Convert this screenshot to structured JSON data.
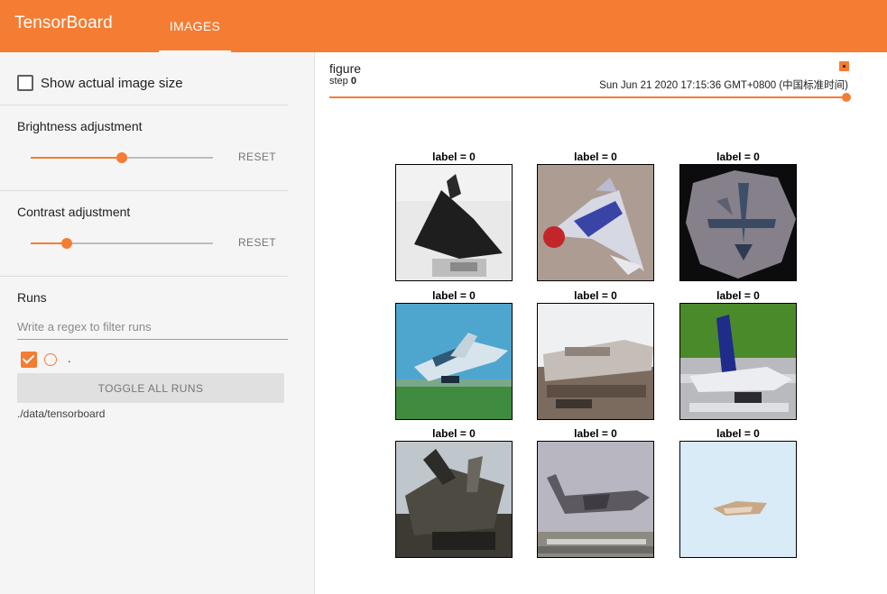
{
  "app": {
    "brand": "TensorBoard",
    "active_tab": "IMAGES"
  },
  "sidebar": {
    "show_actual_size": {
      "label": "Show actual image size",
      "checked": false
    },
    "brightness": {
      "title": "Brightness adjustment",
      "value": 0.5,
      "reset_label": "RESET"
    },
    "contrast": {
      "title": "Contrast adjustment",
      "value": 0.2,
      "reset_label": "RESET"
    },
    "runs": {
      "title": "Runs",
      "filter_placeholder": "Write a regex to filter runs",
      "items": [
        {
          "name": ".",
          "checked": true,
          "color": "#f57c33"
        }
      ],
      "toggle_label": "TOGGLE ALL RUNS",
      "logdir": "./data/tensorboard"
    }
  },
  "card": {
    "tag": "figure",
    "step_label": "step",
    "step_value": "0",
    "timestamp": "Sun Jun 21 2020 17:15:36 GMT+0800 (中国标准时间)",
    "images": [
      {
        "label": "label = 0"
      },
      {
        "label": "label = 0"
      },
      {
        "label": "label = 0"
      },
      {
        "label": "label = 0"
      },
      {
        "label": "label = 0"
      },
      {
        "label": "label = 0"
      },
      {
        "label": "label = 0"
      },
      {
        "label": "label = 0"
      },
      {
        "label": "label = 0"
      }
    ]
  },
  "colors": {
    "accent": "#f57c33",
    "sidebar_bg": "#f5f5f5"
  }
}
